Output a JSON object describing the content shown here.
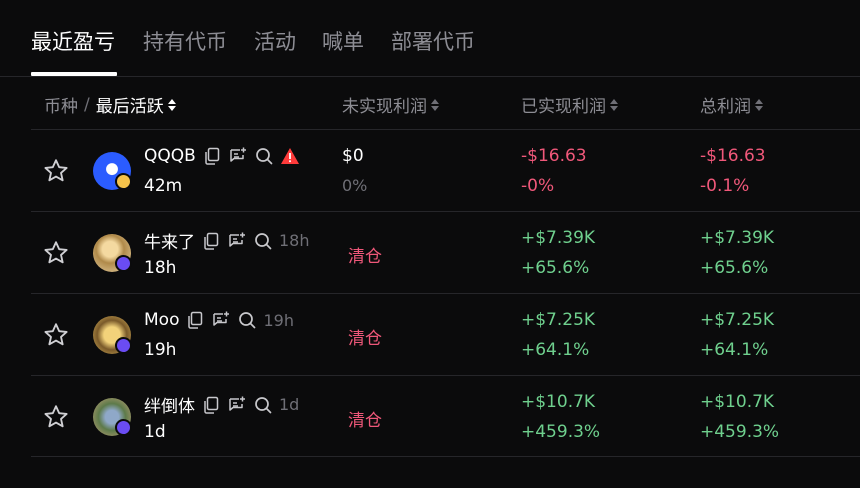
{
  "colors": {
    "positive": "#6fd08e",
    "negative": "#f0587a",
    "muted": "#8d8d94"
  },
  "tabs": [
    {
      "label": "最近盈亏",
      "active": true
    },
    {
      "label": "持有代币",
      "active": false
    },
    {
      "label": "活动",
      "active": false
    },
    {
      "label": "喊单",
      "active": false
    },
    {
      "label": "部署代币",
      "active": false
    }
  ],
  "header": {
    "coin": "币种",
    "recent": "最后活跃",
    "unrealized": "未实现利润",
    "realized": "已实现利润",
    "total": "总利润"
  },
  "rows": [
    {
      "name": "QQQB",
      "age_inline": "",
      "age": "42m",
      "warning": true,
      "unrealized_value": "$0",
      "unrealized_pct": "0%",
      "clear_label": "",
      "realized_value": "-$16.63",
      "realized_pct": "-0%",
      "total_value": "-$16.63",
      "total_pct": "-0.1%",
      "trend": "negative"
    },
    {
      "name": "牛来了",
      "age_inline": "18h",
      "age": "18h",
      "warning": false,
      "unrealized_value": "",
      "unrealized_pct": "",
      "clear_label": "清仓",
      "realized_value": "+$7.39K",
      "realized_pct": "+65.6%",
      "total_value": "+$7.39K",
      "total_pct": "+65.6%",
      "trend": "positive"
    },
    {
      "name": "Moo",
      "age_inline": "19h",
      "age": "19h",
      "warning": false,
      "unrealized_value": "",
      "unrealized_pct": "",
      "clear_label": "清仓",
      "realized_value": "+$7.25K",
      "realized_pct": "+64.1%",
      "total_value": "+$7.25K",
      "total_pct": "+64.1%",
      "trend": "positive"
    },
    {
      "name": "绊倒体",
      "age_inline": "1d",
      "age": "1d",
      "warning": false,
      "unrealized_value": "",
      "unrealized_pct": "",
      "clear_label": "清仓",
      "realized_value": "+$10.7K",
      "realized_pct": "+459.3%",
      "total_value": "+$10.7K",
      "total_pct": "+459.3%",
      "trend": "positive"
    }
  ]
}
